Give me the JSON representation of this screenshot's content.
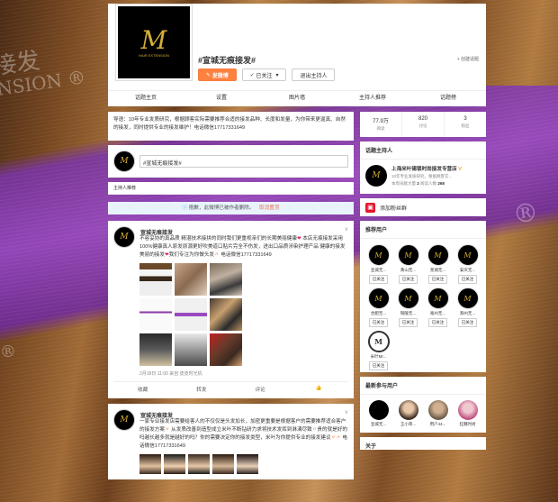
{
  "header": {
    "logo_letter": "M",
    "logo_text": "HAIR EXTENSION",
    "topic_title": "#宣城无痕接发#",
    "create_link": "+ 创建话题",
    "post_button": "发微博",
    "follow_button": "已关注",
    "follow_caret": "▾",
    "quit_host_button": "退出主持人"
  },
  "nav": [
    {
      "label": "话题主页"
    },
    {
      "label": "设置"
    },
    {
      "label": "图片墙"
    },
    {
      "label": "主持人推荐"
    },
    {
      "label": "话题榜"
    }
  ],
  "intro": "导语：10年专业发质研究，根据顾客实际需要推荐合适的接发品种、长度和发量，为你带来更逼真、自然的接发，同时提供专业的接发维护！电话微信17717331649",
  "post_input": "#宣城无痕接发#",
  "sub_tab": "主持人推荐",
  "notice": {
    "text": "抱歉，此微博已被作者删除。",
    "link": "取消置顶"
  },
  "feed": [
    {
      "user": "宣城无痕接发",
      "text_parts": [
        "不容妥协的真品质 精湛技术接拼的同时我们更重视亲们的长期美丽健康",
        " 本店无痕接发采用100%健康真人原发原源更好吹美道口贴片完全不伤发，进出口品质涉染护理产品 健康的接发 美丽的接发",
        "我们专注为你做头发",
        " 电话微信17717331649"
      ],
      "meta": "2月18日 11:00 来自 皮皮时光机",
      "actions": {
        "collect": "收藏",
        "forward": "转发",
        "comment": "评论",
        "like": "👍"
      }
    },
    {
      "user": "宣城无痕接发",
      "text_parts": [
        "一家专业接发店需要给客人的不仅仅是头发加长，加密更重要是根据客户的需要推荐适合客户的接发方案",
        " 从发质改善到造型成立米叶不断钻研力求将技术发挥到淋漓尽致",
        "贵的就是好的吗越长越多就是越好的吗？你的需要决定你的接发类型，米叶为你提供专业的接发建议",
        " 电话微信17717331649"
      ]
    }
  ],
  "side": {
    "stats": [
      {
        "value": "77.9万",
        "label": "阅读"
      },
      {
        "value": "820",
        "label": "讨论"
      },
      {
        "value": "3",
        "label": "粉丝"
      }
    ],
    "host_title": "话题主持人",
    "host": {
      "name": "上海米叶锡锁时尚接发专营店",
      "verified": "V",
      "desc": "10年专业发质研究，根据顾客实...",
      "stats_prefix": "本周贡献大量",
      "stats_value1": "2",
      "stats_mid": "   阅读人数",
      "stats_value2": "268"
    },
    "fans_icon": "▣",
    "fans_group": "添加粉丝群",
    "rec_title": "推荐用户",
    "rec_users": [
      {
        "name": "宣城无...",
        "follow": "已关注"
      },
      {
        "name": "黄山无...",
        "follow": "已关注"
      },
      {
        "name": "芜湖无...",
        "follow": "已关注"
      },
      {
        "name": "安庆无...",
        "follow": "已关注"
      },
      {
        "name": "合肥无...",
        "follow": "已关注"
      },
      {
        "name": "铜陵无...",
        "follow": "已关注"
      },
      {
        "name": "亳州无...",
        "follow": "已关注"
      },
      {
        "name": "滁州无...",
        "follow": "已关注"
      },
      {
        "name": "米叶MI...",
        "follow": "已关注"
      }
    ],
    "recent_title": "最新参与用户",
    "recent_users": [
      {
        "name": "宣城无..."
      },
      {
        "name": "王小草..."
      },
      {
        "name": "用户44..."
      },
      {
        "name": "狂魏时尚"
      }
    ],
    "about_title": "关于"
  },
  "colors": {
    "accent": "#ff8140",
    "link": "#eb7350",
    "notice_bg": "#e8f3fc",
    "heart": "#e0245e"
  }
}
